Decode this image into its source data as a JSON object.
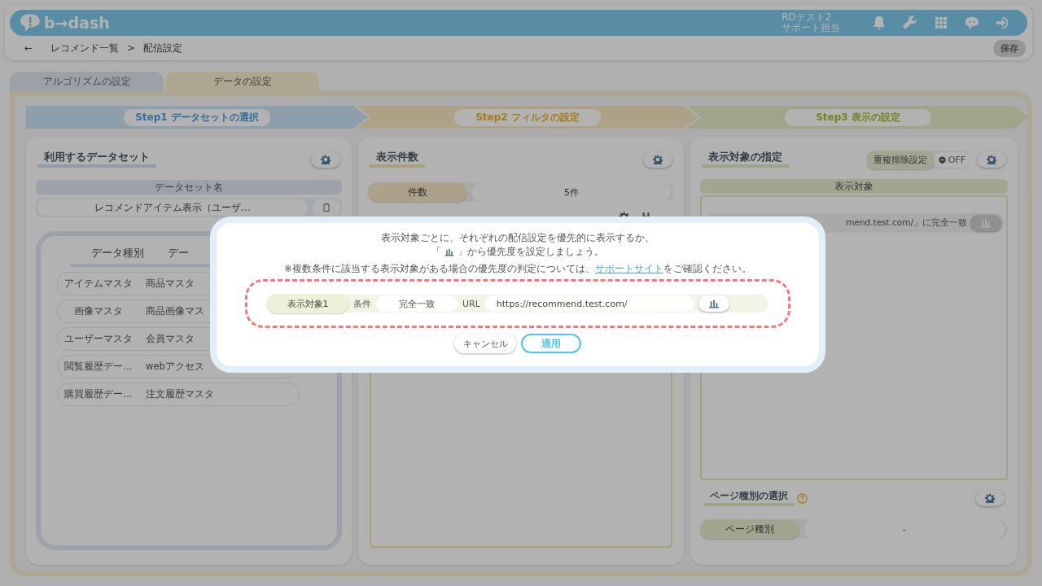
{
  "header": {
    "logo": "b→dash",
    "user_name": "RDテスト2",
    "user_role": "サポート担当"
  },
  "breadcrumb": {
    "back": "←",
    "items": [
      "レコメンド一覧",
      "配信設定"
    ],
    "separator": ">"
  },
  "save_button": {
    "label": "保存",
    "disabled": true
  },
  "tabs": [
    {
      "label": "アルゴリズムの設定",
      "selected": false
    },
    {
      "label": "データの設定",
      "selected": true
    }
  ],
  "steps": [
    {
      "label": "Step1 データセットの選択",
      "kind": "dataset"
    },
    {
      "label": "Step2 フィルタの設定",
      "kind": "filter"
    },
    {
      "label": "Step3 表示の設定",
      "kind": "display"
    }
  ],
  "dataset_panel": {
    "title": "利用するデータセット",
    "column_header": "データセット名",
    "dataset_name": "レコメンドアイテム表示（ユーザ…",
    "columns": [
      "データ種別",
      "デー"
    ],
    "rows": [
      [
        "アイテムマスタ",
        "商品マスタ"
      ],
      [
        "画像マスタ",
        "商品画像マス"
      ],
      [
        "ユーザーマスタ",
        "会員マスタ"
      ],
      [
        "閲覧履歴デー…",
        "webアクセス"
      ],
      [
        "購買履歴デー…",
        "注文履歴マスタ"
      ]
    ]
  },
  "count_panel": {
    "title": "表示件数",
    "count_label": "件数",
    "count_value": "5件"
  },
  "target_panel": {
    "title": "表示対象の指定",
    "dedupe_label": "重複排除設定",
    "dedupe_toggle": {
      "label": "OFF",
      "on": false
    },
    "column_header": "表示対象",
    "target_text": "mend.test.com/」に完全一致",
    "page_type_title": "ページ種別の選択",
    "page_type_label": "ページ種別",
    "page_type_value": "-"
  },
  "modal": {
    "line1": "表示対象ごとに、それぞれの配信設定を優先的に表示するか、",
    "line2_open": "「",
    "line2_close": "」から優先度を設定しましょう。",
    "note_before": "※複数条件に該当する表示対象がある場合の優先度の判定については、",
    "note_link": "サポートサイト",
    "note_after": "をご確認ください。",
    "rule": {
      "label": "表示対象1",
      "condition_label": "条件",
      "condition": "完全一致",
      "url_label": "URL",
      "url": "https://recommend.test.com/"
    },
    "cancel": "キャンセル",
    "apply": "適用"
  }
}
